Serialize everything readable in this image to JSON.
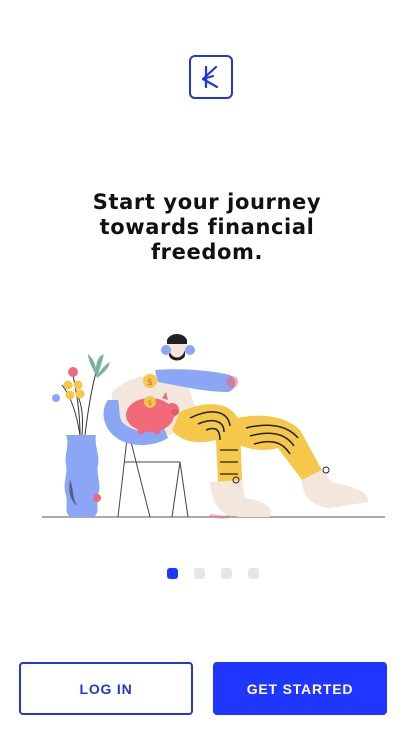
{
  "brand": {
    "logo_icon": "brand-k-logo-icon",
    "accent": "#1f36ff"
  },
  "onboarding": {
    "headline_line1": "Start your journey",
    "headline_line2": "towards financial",
    "headline_line3": "freedom.",
    "illustration_icon": "person-relaxing-with-piggy-bank-illustration",
    "pager": {
      "total": 4,
      "active_index": 0
    }
  },
  "actions": {
    "login_label": "LOG IN",
    "get_started_label": "GET STARTED"
  }
}
